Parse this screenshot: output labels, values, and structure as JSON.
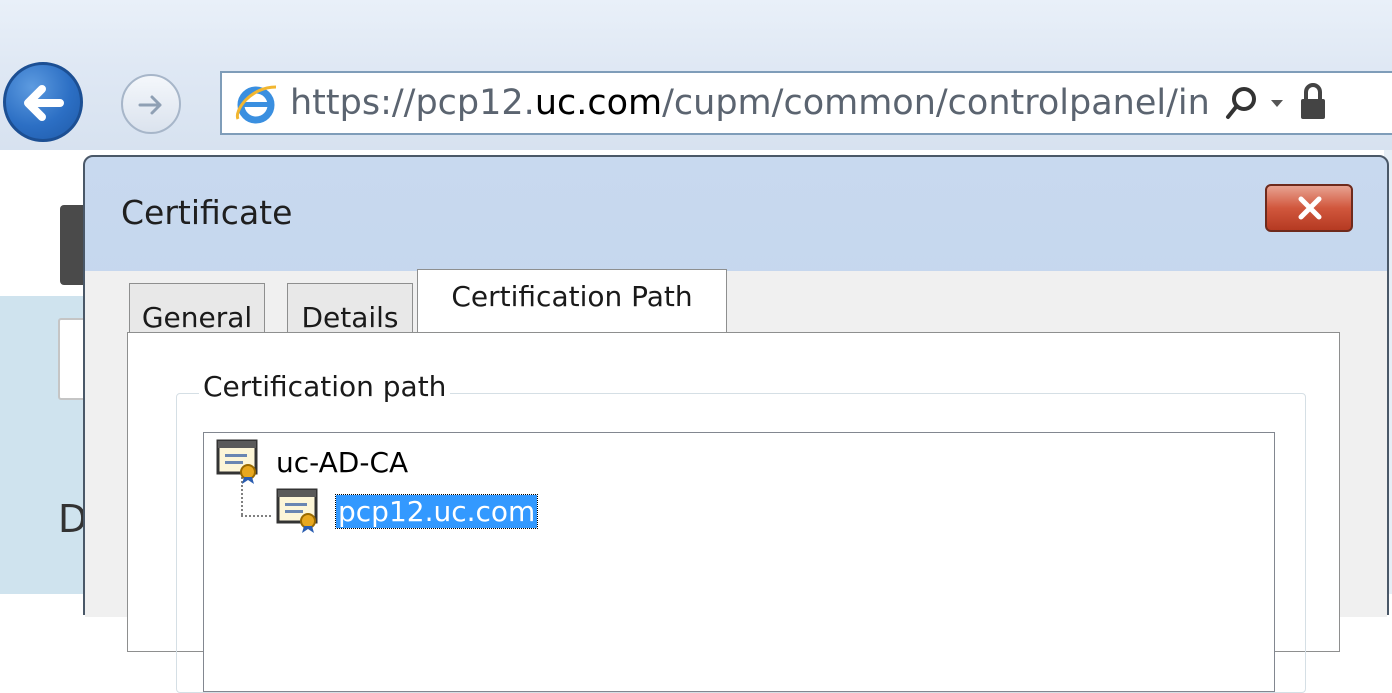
{
  "browser": {
    "url_scheme": "https://",
    "url_host": "uc.com",
    "url_host_prefix": "pcp12.",
    "url_path": "/cupm/common/controlpanel/in",
    "icons": [
      "back-icon",
      "forward-icon",
      "ie-icon",
      "search-icon",
      "dropdown-icon",
      "lock-icon"
    ]
  },
  "dialog": {
    "title": "Certificate",
    "tabs": [
      {
        "label": "General",
        "active": false
      },
      {
        "label": "Details",
        "active": false
      },
      {
        "label": "Certification Path",
        "active": true
      }
    ],
    "group_label": "Certification path",
    "tree": [
      {
        "label": "uc-AD-CA",
        "selected": false,
        "level": 0
      },
      {
        "label": "pcp12.uc.com",
        "selected": true,
        "level": 1
      }
    ]
  },
  "background": {
    "partial_letter": "D"
  },
  "colors": {
    "selection": "#3399ff",
    "close_button": "#c94a2f",
    "dialog_frame": "#bfd2ea"
  }
}
